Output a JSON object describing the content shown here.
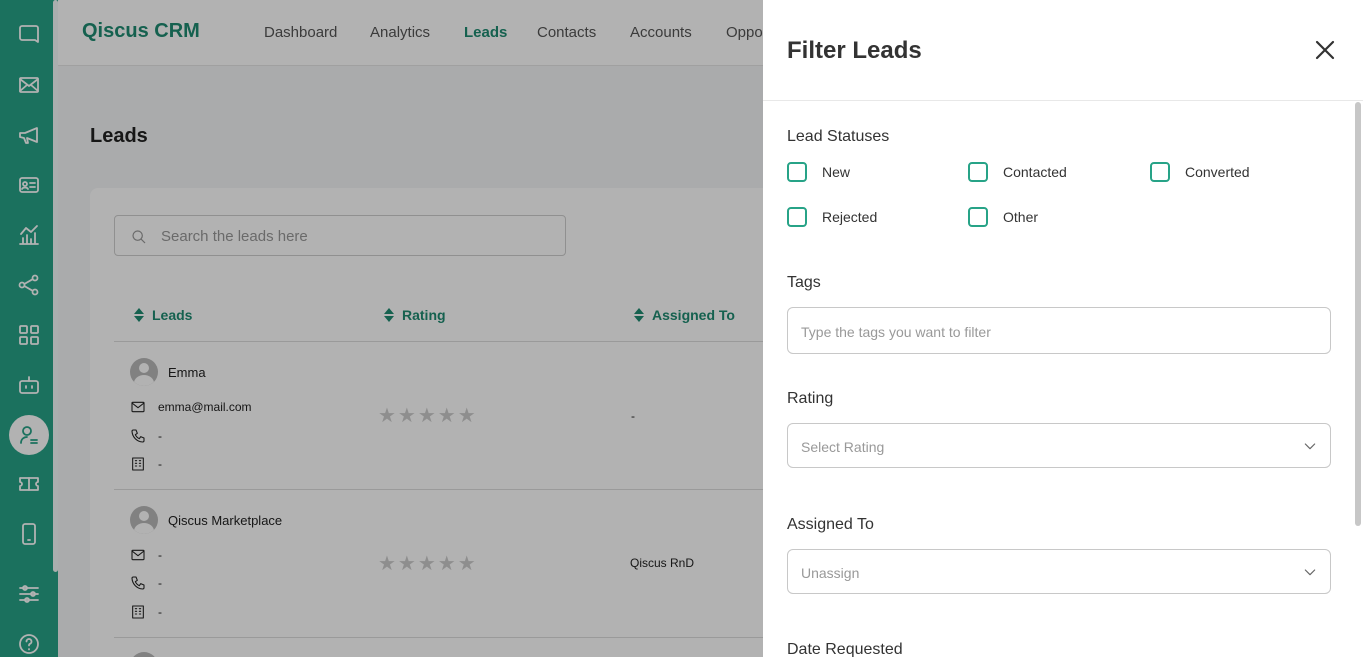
{
  "app": {
    "brand": "Qiscus CRM"
  },
  "nav": {
    "items": [
      {
        "label": "Dashboard",
        "active": false
      },
      {
        "label": "Analytics",
        "active": false
      },
      {
        "label": "Leads",
        "active": true
      },
      {
        "label": "Contacts",
        "active": false
      },
      {
        "label": "Accounts",
        "active": false
      },
      {
        "label": "Oppo",
        "active": false
      }
    ]
  },
  "sidebar": {
    "icons": [
      "chat-icon",
      "mail-icon",
      "megaphone-icon",
      "contact-card-icon",
      "analytics-icon",
      "share-icon",
      "apps-icon",
      "bot-icon",
      "crm-user-icon",
      "ticket-icon",
      "mobile-icon",
      "settings-sliders-icon",
      "help-icon"
    ],
    "active": "crm-user-icon"
  },
  "page": {
    "title": "Leads",
    "search_placeholder": "Search the leads here",
    "columns": [
      "Leads",
      "Rating",
      "Assigned To"
    ],
    "rows": [
      {
        "name": "Emma",
        "email": "emma@mail.com",
        "phone": "-",
        "company": "-",
        "rating": 0,
        "assigned": "-"
      },
      {
        "name": "Qiscus Marketplace",
        "email": "-",
        "phone": "-",
        "company": "-",
        "rating": 0,
        "assigned": "Qiscus RnD"
      }
    ]
  },
  "filter": {
    "title": "Filter Leads",
    "statuses_label": "Lead Statuses",
    "statuses": [
      "New",
      "Contacted",
      "Converted",
      "Rejected",
      "Other"
    ],
    "tags_label": "Tags",
    "tags_placeholder": "Type the tags you want to filter",
    "rating_label": "Rating",
    "rating_value": "Select Rating",
    "assigned_label": "Assigned To",
    "assigned_value": "Unassign",
    "date_label": "Date Requested"
  },
  "colors": {
    "primary": "#27a387",
    "primary_dark": "#1f8b72"
  }
}
